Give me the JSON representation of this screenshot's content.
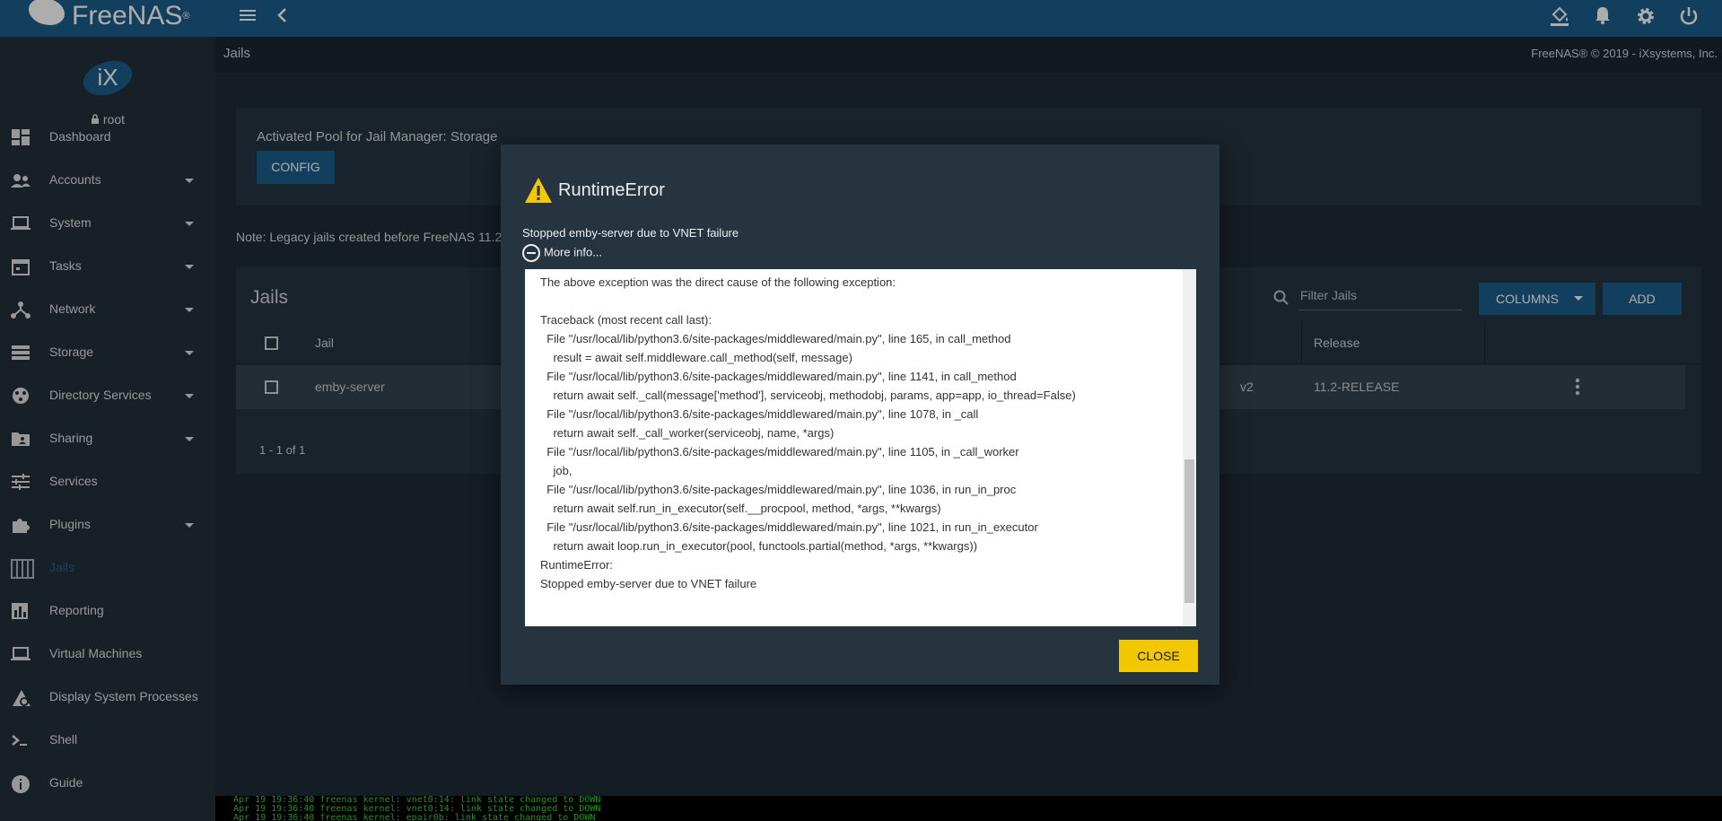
{
  "app": {
    "brand": "FreeNAS",
    "brand_mark": "®"
  },
  "sidebar": {
    "user": "root",
    "items": [
      {
        "label": "Dashboard",
        "icon": "dashboard-icon",
        "expandable": false
      },
      {
        "label": "Accounts",
        "icon": "accounts-icon",
        "expandable": true
      },
      {
        "label": "System",
        "icon": "laptop-icon",
        "expandable": true
      },
      {
        "label": "Tasks",
        "icon": "calendar-icon",
        "expandable": true
      },
      {
        "label": "Network",
        "icon": "network-icon",
        "expandable": true
      },
      {
        "label": "Storage",
        "icon": "storage-icon",
        "expandable": true
      },
      {
        "label": "Directory Services",
        "icon": "directory-icon",
        "expandable": true
      },
      {
        "label": "Sharing",
        "icon": "folder-share-icon",
        "expandable": true
      },
      {
        "label": "Services",
        "icon": "tune-icon",
        "expandable": false
      },
      {
        "label": "Plugins",
        "icon": "puzzle-icon",
        "expandable": true
      },
      {
        "label": "Jails",
        "icon": "jail-icon",
        "expandable": false
      },
      {
        "label": "Reporting",
        "icon": "bar-chart-icon",
        "expandable": false
      },
      {
        "label": "Virtual Machines",
        "icon": "laptop-icon",
        "expandable": false
      },
      {
        "label": "Display System Processes",
        "icon": "speedometer-icon",
        "expandable": false
      },
      {
        "label": "Shell",
        "icon": "console-icon",
        "expandable": false
      },
      {
        "label": "Guide",
        "icon": "info-icon",
        "expandable": false
      }
    ],
    "active": "Jails"
  },
  "header": {
    "page": "Jails",
    "copyright": "FreeNAS® © 2019 - iXsystems, Inc."
  },
  "pool": {
    "text": "Activated Pool for Jail Manager: Storage",
    "config_label": "CONFIG"
  },
  "note": "Note: Legacy jails created before FreeNAS 11.2",
  "jails": {
    "title": "Jails",
    "filter_placeholder": "Filter Jails",
    "columns_label": "COLUMNS",
    "add_label": "ADD",
    "headers": {
      "jail": "Jail",
      "release": "Release"
    },
    "rows": [
      {
        "jail": "emby-server",
        "partial": "v2",
        "release": "11.2-RELEASE"
      }
    ],
    "pager": "1 - 1 of 1"
  },
  "console_lines": [
    "Apr 19 19:36:40 freenas kernel: vnet0:14: link state changed to DOWN",
    "Apr 19 19:36:40 freenas kernel: vnet0:14: link state changed to DOWN",
    "Apr 19 19:36:40 freenas kernel: epair0b: link state changed to DOWN"
  ],
  "dialog": {
    "title": "RuntimeError",
    "message": "Stopped emby-server due to VNET failure",
    "more_info": "More info...",
    "traceback": "The above exception was the direct cause of the following exception:\n\nTraceback (most recent call last):\n  File \"/usr/local/lib/python3.6/site-packages/middlewared/main.py\", line 165, in call_method\n    result = await self.middleware.call_method(self, message)\n  File \"/usr/local/lib/python3.6/site-packages/middlewared/main.py\", line 1141, in call_method\n    return await self._call(message['method'], serviceobj, methodobj, params, app=app, io_thread=False)\n  File \"/usr/local/lib/python3.6/site-packages/middlewared/main.py\", line 1078, in _call\n    return await self._call_worker(serviceobj, name, *args)\n  File \"/usr/local/lib/python3.6/site-packages/middlewared/main.py\", line 1105, in _call_worker\n    job,\n  File \"/usr/local/lib/python3.6/site-packages/middlewared/main.py\", line 1036, in run_in_proc\n    return await self.run_in_executor(self.__procpool, method, *args, **kwargs)\n  File \"/usr/local/lib/python3.6/site-packages/middlewared/main.py\", line 1021, in run_in_executor\n    return await loop.run_in_executor(pool, functools.partial(method, *args, **kwargs))\nRuntimeError:\nStopped emby-server due to VNET failure",
    "close_label": "CLOSE"
  },
  "colors": {
    "topbar": "#1c5d8c",
    "sidebar": "#222f3a",
    "content_bg": "#1e2a35",
    "card": "#263440",
    "accent_yellow": "#f3c800",
    "active_nav": "#2a5d8a"
  }
}
